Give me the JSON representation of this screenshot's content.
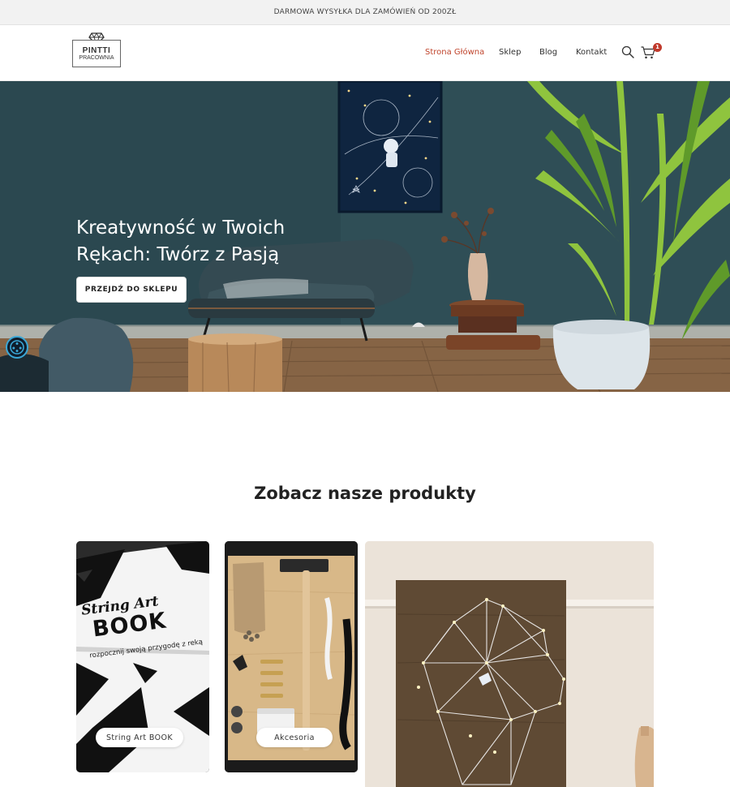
{
  "announcement": "DARMOWA WYSYŁKA DLA ZAMÓWIEŃ OD 200ZŁ",
  "logo": {
    "line1": "PINTTI",
    "line2": "PRACOWNIA"
  },
  "nav": {
    "items": [
      {
        "label": "Strona Główna",
        "active": true
      },
      {
        "label": "Sklep",
        "active": false
      },
      {
        "label": "Blog",
        "active": false
      },
      {
        "label": "Kontakt",
        "active": false
      }
    ],
    "cart_count": "1"
  },
  "hero": {
    "title": "Kreatywność w Twoich Rękach: Twórz z Pasją",
    "button_label": "PRZEJDŹ DO SKLEPU"
  },
  "products_section": {
    "title": "Zobacz nasze produkty",
    "cards": [
      {
        "label": "String Art BOOK",
        "image_text_1": "String Art",
        "image_text_2": "BOOK",
        "image_text_3": "rozpocznij swoją przygodę z reką"
      },
      {
        "label": "Akcesoria"
      },
      {
        "label": ""
      }
    ]
  },
  "colors": {
    "accent": "#c0452d",
    "badge": "#c0392b",
    "hero_wall": "#2f4f57"
  },
  "icons": [
    "search-icon",
    "cart-icon",
    "accessibility-icon"
  ]
}
